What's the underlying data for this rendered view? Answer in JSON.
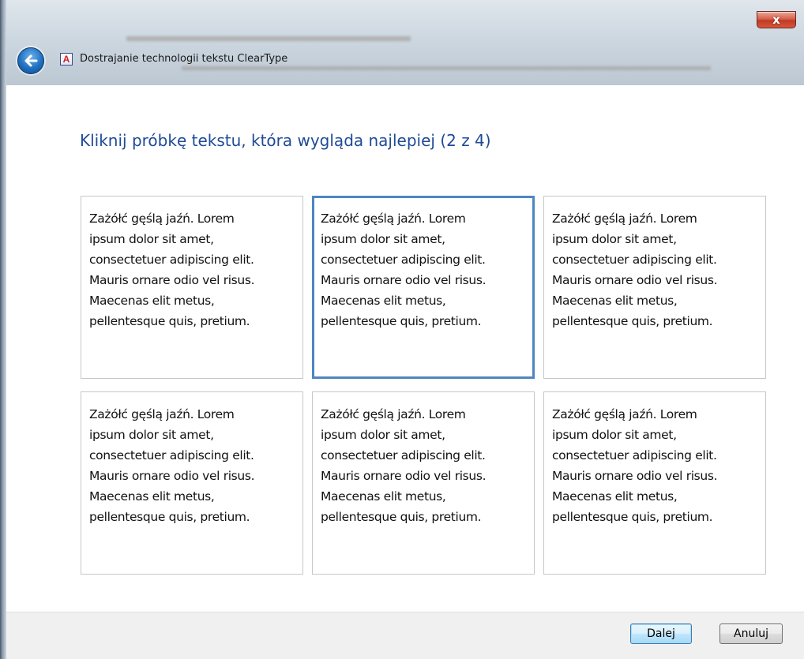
{
  "window": {
    "title": "Dostrajanie technologii tekstu ClearType",
    "close_label": "x"
  },
  "main": {
    "heading": "Kliknij próbkę tekstu, która wygląda najlepiej (2 z 4)",
    "selected_index": 2,
    "samples": [
      {
        "lines": [
          "Zażółć gęślą jaźń. Lorem",
          "ipsum dolor sit amet,",
          "consectetuer adipiscing elit.",
          "Mauris ornare odio vel risus.",
          "Maecenas elit metus,",
          "pellentesque quis, pretium."
        ]
      },
      {
        "lines": [
          "Zażółć gęślą jaźń. Lorem",
          "ipsum dolor sit amet,",
          "consectetuer adipiscing elit.",
          "Mauris ornare odio vel risus.",
          "Maecenas elit metus,",
          "pellentesque quis, pretium."
        ]
      },
      {
        "lines": [
          "Zażółć gęślą jaźń. Lorem",
          "ipsum dolor sit amet,",
          "consectetuer adipiscing elit.",
          "Mauris ornare odio vel risus.",
          "Maecenas elit metus,",
          "pellentesque quis, pretium."
        ]
      },
      {
        "lines": [
          "Zażółć gęślą jaźń. Lorem",
          "ipsum dolor sit amet,",
          "consectetuer adipiscing elit.",
          "Mauris ornare odio vel risus.",
          "Maecenas elit metus,",
          "pellentesque quis, pretium."
        ]
      },
      {
        "lines": [
          "Zażółć gęślą jaźń. Lorem",
          "ipsum dolor sit amet,",
          "consectetuer adipiscing elit.",
          "Mauris ornare odio vel risus.",
          "Maecenas elit metus,",
          "pellentesque quis, pretium."
        ]
      },
      {
        "lines": [
          "Zażółć gęślą jaźń. Lorem",
          "ipsum dolor sit amet,",
          "consectetuer adipiscing elit.",
          "Mauris ornare odio vel risus.",
          "Maecenas elit metus,",
          "pellentesque quis, pretium."
        ]
      }
    ]
  },
  "footer": {
    "next_label": "Dalej",
    "cancel_label": "Anuluj"
  },
  "colors": {
    "heading": "#1e4a96",
    "selected_border": "#4e86c0",
    "sample_border": "#c7c7c7"
  },
  "icons": {
    "back": "back-arrow-icon",
    "app": "cleartype-app-icon",
    "close": "close-icon"
  }
}
